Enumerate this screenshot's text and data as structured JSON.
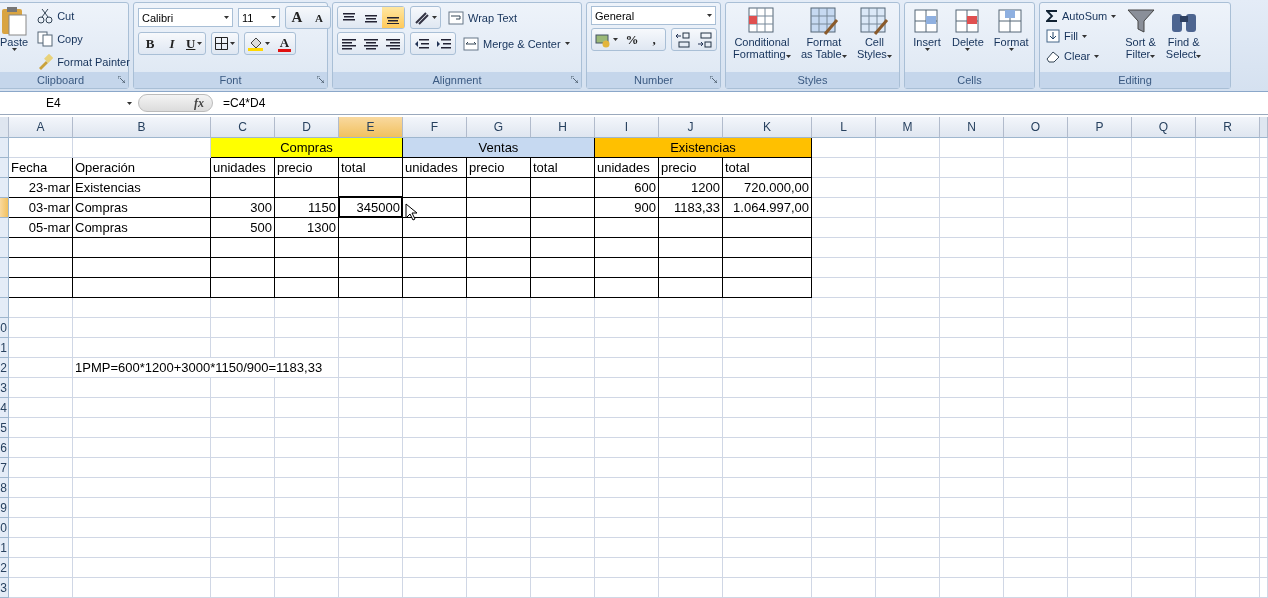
{
  "ribbon": {
    "clipboard": {
      "paste": "Paste",
      "items": [
        "Cut",
        "Copy",
        "Format Painter"
      ],
      "label": "Clipboard"
    },
    "font": {
      "font_name": "Calibri",
      "font_size": "11",
      "grow": "A",
      "shrink": "A",
      "bold": "B",
      "italic": "I",
      "underline": "U",
      "font_color": "A",
      "label": "Font"
    },
    "alignment": {
      "vertical": [
        {
          "selected": false
        },
        {
          "selected": false
        },
        {
          "selected": true
        }
      ],
      "wrap": "Wrap Text",
      "merge": "Merge & Center",
      "label": "Alignment"
    },
    "number": {
      "format": "General",
      "percent": "%",
      "comma": ",",
      "label": "Number"
    },
    "styles": {
      "buttons": [
        {
          "lines": [
            "Conditional",
            "Formatting"
          ]
        },
        {
          "lines": [
            "Format",
            "as Table"
          ]
        },
        {
          "lines": [
            "Cell",
            "Styles"
          ]
        }
      ],
      "label": "Styles"
    },
    "cells": {
      "buttons": [
        "Insert",
        "Delete",
        "Format"
      ],
      "label": "Cells"
    },
    "editing": {
      "small": [
        "AutoSum",
        "Fill",
        "Clear"
      ],
      "buttons": [
        {
          "lines": [
            "Sort &",
            "Filter"
          ]
        },
        {
          "lines": [
            "Find &",
            "Select"
          ]
        }
      ],
      "label": "Editing"
    }
  },
  "formula_bar": {
    "name_box": "E4",
    "fx": "fx",
    "formula": "=C4*D4"
  },
  "sheet": {
    "columns": [
      {
        "label": "A",
        "selected": false
      },
      {
        "label": "B",
        "selected": false
      },
      {
        "label": "C",
        "selected": false
      },
      {
        "label": "D",
        "selected": false
      },
      {
        "label": "E",
        "selected": true
      },
      {
        "label": "F",
        "selected": false
      },
      {
        "label": "G",
        "selected": false
      },
      {
        "label": "H",
        "selected": false
      },
      {
        "label": "I",
        "selected": false
      },
      {
        "label": "J",
        "selected": false
      },
      {
        "label": "K",
        "selected": false
      },
      {
        "label": "L",
        "selected": false
      },
      {
        "label": "M",
        "selected": false
      },
      {
        "label": "N",
        "selected": false
      },
      {
        "label": "O",
        "selected": false
      },
      {
        "label": "P",
        "selected": false
      },
      {
        "label": "Q",
        "selected": false
      },
      {
        "label": "R",
        "selected": false
      }
    ],
    "bands": [
      {
        "text": "Compras",
        "color": "#ffff00"
      },
      {
        "text": "Ventas",
        "color": "#c6d9f1"
      },
      {
        "text": "Existencias",
        "color": "#ffc000"
      }
    ],
    "rows": [
      {
        "selected": false,
        "cells": []
      },
      {
        "selected": false,
        "cells": [
          {
            "text": "Fecha",
            "kind": "text",
            "selected": false
          },
          {
            "text": "Operación",
            "kind": "text",
            "selected": false
          },
          {
            "text": "unidades",
            "kind": "text",
            "selected": false
          },
          {
            "text": "precio",
            "kind": "text",
            "selected": false
          },
          {
            "text": "total",
            "kind": "text",
            "selected": false
          },
          {
            "text": "unidades",
            "kind": "text",
            "selected": false
          },
          {
            "text": "precio",
            "kind": "text",
            "selected": false
          },
          {
            "text": "total",
            "kind": "text",
            "selected": false
          },
          {
            "text": "unidades",
            "kind": "text",
            "selected": false
          },
          {
            "text": "precio",
            "kind": "text",
            "selected": false
          },
          {
            "text": "total",
            "kind": "text",
            "selected": false
          }
        ]
      },
      {
        "selected": false,
        "cells": [
          {
            "text": "23-mar",
            "kind": "number",
            "selected": false
          },
          {
            "text": "Existencias",
            "kind": "text",
            "selected": false
          },
          null,
          null,
          null,
          null,
          null,
          null,
          {
            "text": "600",
            "kind": "number",
            "selected": false
          },
          {
            "text": "1200",
            "kind": "number",
            "selected": false
          },
          {
            "text": "720.000,00",
            "kind": "number",
            "selected": false
          }
        ]
      },
      {
        "selected": true,
        "cells": [
          {
            "text": "03-mar",
            "kind": "number",
            "selected": false
          },
          {
            "text": "Compras",
            "kind": "text",
            "selected": false
          },
          {
            "text": "300",
            "kind": "number",
            "selected": false
          },
          {
            "text": "1150",
            "kind": "number",
            "selected": false
          },
          {
            "text": "345000",
            "kind": "number",
            "selected": true
          },
          null,
          null,
          null,
          {
            "text": "900",
            "kind": "number",
            "selected": false
          },
          {
            "text": "1183,33",
            "kind": "number",
            "selected": false
          },
          {
            "text": "1.064.997,00",
            "kind": "number",
            "selected": false
          }
        ]
      },
      {
        "selected": false,
        "cells": [
          {
            "text": "05-mar",
            "kind": "number",
            "selected": false
          },
          {
            "text": "Compras",
            "kind": "text",
            "selected": false
          },
          {
            "text": "500",
            "kind": "number",
            "selected": false
          },
          {
            "text": "1300",
            "kind": "number",
            "selected": false
          }
        ]
      },
      {
        "selected": false,
        "cells": []
      },
      {
        "selected": false,
        "cells": []
      },
      {
        "selected": false,
        "cells": []
      },
      {
        "selected": false,
        "cells": []
      },
      {
        "header": "0",
        "selected": false,
        "cells": []
      },
      {
        "header": "1",
        "selected": false,
        "cells": []
      },
      {
        "header": "2",
        "selected": false,
        "cells": [
          null,
          {
            "text": "1PMP=600*1200+3000*1150/900=1183,33",
            "kind": "text",
            "selected": false
          }
        ]
      },
      {
        "header": "3",
        "selected": false,
        "cells": []
      },
      {
        "header": "4",
        "selected": false,
        "cells": []
      },
      {
        "header": "5",
        "selected": false,
        "cells": []
      },
      {
        "header": "6",
        "selected": false,
        "cells": []
      },
      {
        "header": "7",
        "selected": false,
        "cells": []
      },
      {
        "header": "8",
        "selected": false,
        "cells": []
      },
      {
        "header": "9",
        "selected": false,
        "cells": []
      },
      {
        "header": "0",
        "selected": false,
        "cells": []
      },
      {
        "header": "1",
        "selected": false,
        "cells": []
      },
      {
        "header": "2",
        "selected": false,
        "cells": []
      },
      {
        "header": "3",
        "selected": false,
        "cells": []
      }
    ]
  }
}
